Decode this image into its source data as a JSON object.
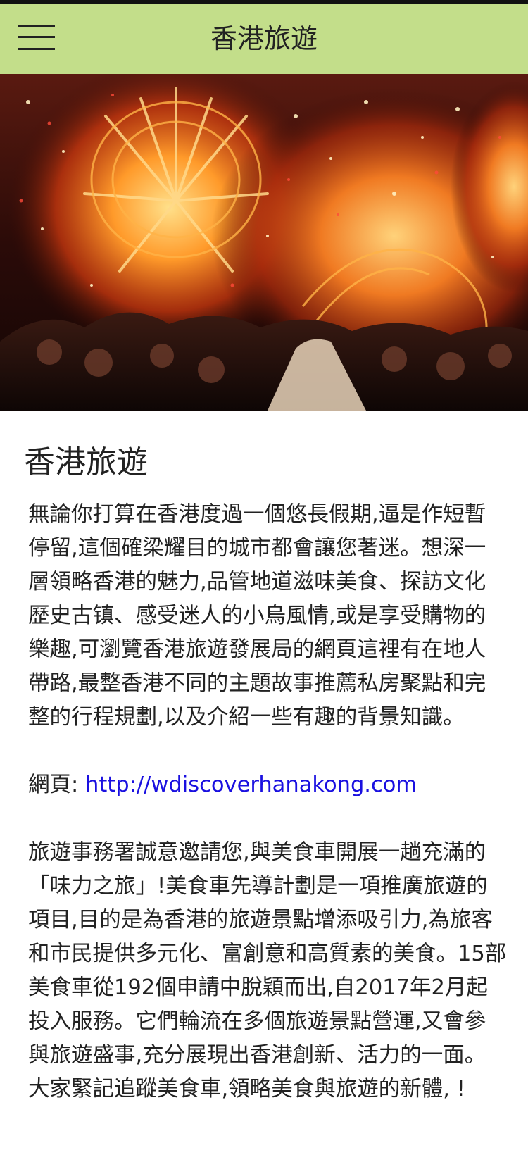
{
  "app": {
    "title": "香港旅遊",
    "menu_icon": "hamburger-menu-icon"
  },
  "hero": {
    "image": "dragon-dance-festival-photo"
  },
  "article": {
    "title": "香港旅遊",
    "paragraph1": "無論你打算在香港度過一個悠長假期,逼是作短暫停留,這個確梁耀目的城市都會讓您著迷。想深一層領略香港的魅力,品管地道滋味美食、探訪文化歷史古镇、感受迷人的小烏風情,或是享受購物的樂趣,可瀏覽香港旅遊發展局的網頁這裡有在地人帶路,最整香港不同的主題故事推薦私房聚點和完整的行程規劃,以及介紹一些有趣的背景知識。",
    "web_label": "網頁: ",
    "web_url": "http://wdiscoverhanakong.com",
    "paragraph2": "旅遊事務署誠意邀請您,與美食車開展一趟充滿的「味力之旅」!美食車先導計劃是一項推廣旅遊的項目,目的是為香港的旅遊景點增添吸引力,為旅客和市民提供多元化、富創意和高質素的美食。15部美食車從192個申請中脫穎而出,自2017年2月起投入服務。它們輪流在多個旅遊景點營運,又會參與旅遊盛事,充分展現出香港創新、活力的一面。大家緊記追蹤美食車,領略美食與旅遊的新體, !"
  },
  "colors": {
    "appbar": "#c3de8a",
    "link": "#1a10e0",
    "text": "#222222"
  }
}
